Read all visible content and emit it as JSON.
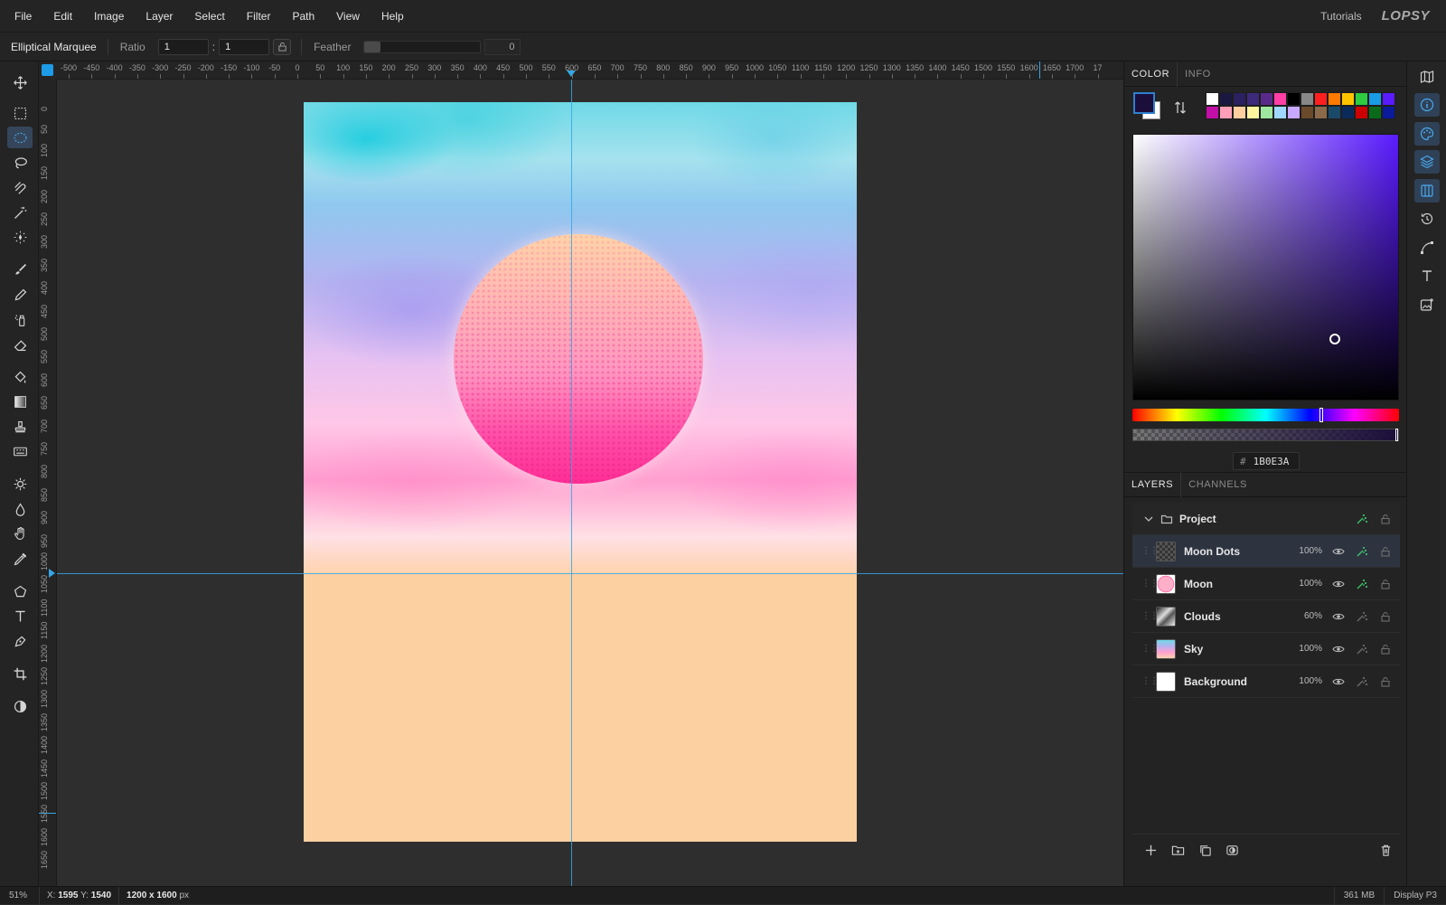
{
  "menu": {
    "items": [
      "File",
      "Edit",
      "Image",
      "Layer",
      "Select",
      "Filter",
      "Path",
      "View",
      "Help"
    ],
    "tutorials": "Tutorials",
    "logo": "LOPSY"
  },
  "options": {
    "tool_name": "Elliptical Marquee",
    "ratio_label": "Ratio",
    "ratio_w": "1",
    "ratio_separator": ":",
    "ratio_h": "1",
    "feather_label": "Feather",
    "feather_value": "0"
  },
  "rulers": {
    "top_labels": [
      "-500",
      "-450",
      "-400",
      "-350",
      "-300",
      "-250",
      "-200",
      "-150",
      "-100",
      "-50",
      "0",
      "50",
      "100",
      "150",
      "200",
      "250",
      "300",
      "350",
      "400",
      "450",
      "500",
      "550",
      "600",
      "650",
      "700",
      "750",
      "800",
      "850",
      "900",
      "950",
      "1000",
      "1050",
      "1100",
      "1150",
      "1200",
      "1250",
      "1300",
      "1350",
      "1400",
      "1450",
      "1500",
      "1550",
      "1600",
      "1650",
      "1700",
      "17"
    ],
    "left_labels": [
      "0",
      "50",
      "100",
      "150",
      "200",
      "250",
      "300",
      "350",
      "400",
      "450",
      "500",
      "550",
      "600",
      "650",
      "700",
      "750",
      "800",
      "850",
      "900",
      "950",
      "1000",
      "1050",
      "1100",
      "1150",
      "1200",
      "1250",
      "1300",
      "1350",
      "1400",
      "1450",
      "1500",
      "1550",
      "1600",
      "1650"
    ]
  },
  "color_panel": {
    "tabs": [
      "COLOR",
      "INFO"
    ],
    "foreground": "#1B0E3A",
    "background": "#FFFFFF",
    "hex_prefix": "#",
    "hex_value": "1B0E3A",
    "hue_fraction": 0.71,
    "saturation": 0.76,
    "value": 0.23,
    "swatches": [
      "#ffffff",
      "#1a1840",
      "#2b2060",
      "#3d2a7a",
      "#5a2a8a",
      "#ff3fa5",
      "#000000",
      "#888888",
      "#ff1f1f",
      "#ff7a00",
      "#ffc400",
      "#2ecc40",
      "#1a9be6",
      "#5a1bff",
      "#c40ea8",
      "#ff9fb8",
      "#ffcf9f",
      "#fff59f",
      "#9fe79f",
      "#9fd7ff",
      "#c8a9ff",
      "#6a4a2a",
      "#8a6a4a",
      "#1a4a6a",
      "#0a2a5a",
      "#cc0000",
      "#0a6a1a",
      "#0a1a9a"
    ]
  },
  "layers_panel": {
    "tabs": [
      "LAYERS",
      "CHANNELS"
    ],
    "group_name": "Project",
    "layers": [
      {
        "name": "Moon Dots",
        "opacity": "100%",
        "selected": true,
        "thumb": "dots",
        "fx_on": true
      },
      {
        "name": "Moon",
        "opacity": "100%",
        "selected": false,
        "thumb": "moon",
        "fx_on": true
      },
      {
        "name": "Clouds",
        "opacity": "60%",
        "selected": false,
        "thumb": "clouds",
        "fx_on": false
      },
      {
        "name": "Sky",
        "opacity": "100%",
        "selected": false,
        "thumb": "sky",
        "fx_on": false
      },
      {
        "name": "Background",
        "opacity": "100%",
        "selected": false,
        "thumb": "white",
        "fx_on": false
      }
    ]
  },
  "status": {
    "zoom": "51%",
    "x_label": "X:",
    "x_value": "1595",
    "y_label": "Y:",
    "y_value": "1540",
    "doc_size": "1200 x 1600",
    "doc_unit": "px",
    "memory": "361 MB",
    "color_profile": "Display P3"
  },
  "colors": {
    "accent": "#1e9be6",
    "guide": "#34a7e6",
    "active_tool_bg": "#35465a"
  }
}
